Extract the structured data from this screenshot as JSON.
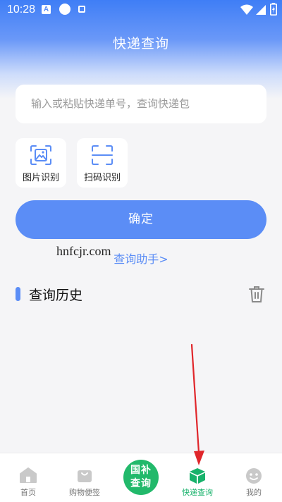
{
  "status_bar": {
    "time": "10:28",
    "icons": [
      "android-a-icon",
      "circle-icon",
      "square-icon",
      "wifi-icon",
      "signal-icon",
      "battery-charging-icon"
    ]
  },
  "header": {
    "title": "快递查询"
  },
  "search": {
    "placeholder": "输入或粘贴快递单号，查询快递包"
  },
  "tools": [
    {
      "label": "图片识别",
      "icon": "image-recognition-icon"
    },
    {
      "label": "扫码识别",
      "icon": "scan-code-icon"
    }
  ],
  "confirm_button": {
    "label": "确定"
  },
  "helper_link": {
    "label": "查询助手>"
  },
  "watermark": {
    "text": "hnfcjr.com"
  },
  "history": {
    "title": "查询历史",
    "delete_icon": "trash-icon"
  },
  "bottom_nav": {
    "items": [
      {
        "label": "首页",
        "icon": "home-icon"
      },
      {
        "label": "购物便签",
        "icon": "shopping-bag-icon"
      },
      {
        "label": "国补\n查询",
        "icon": "center-badge"
      },
      {
        "label": "快递查询",
        "icon": "package-box-icon",
        "active": true
      },
      {
        "label": "我的",
        "icon": "face-icon"
      }
    ],
    "center_line1": "国补",
    "center_line2": "查询"
  },
  "colors": {
    "primary": "#5b8df6",
    "active_green": "#18b26b",
    "center_green": "#22b96b",
    "annotation_arrow": "#e0262b"
  }
}
